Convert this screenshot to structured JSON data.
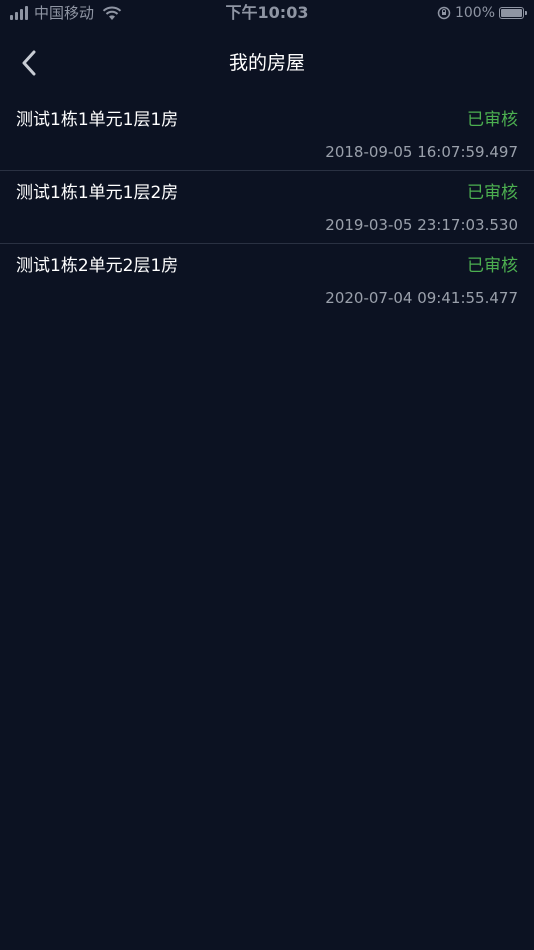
{
  "status_bar": {
    "carrier": "中国移动",
    "time": "下午10:03",
    "battery": "100%",
    "icons": [
      "signal-icon",
      "wifi-icon",
      "rotation-lock-icon",
      "battery-icon"
    ]
  },
  "nav": {
    "title": "我的房屋",
    "back_icon": "chevron-left-icon"
  },
  "houses": [
    {
      "name": "测试1栋1单元1层1房",
      "status": "已审核",
      "time": "2018-09-05 16:07:59.497"
    },
    {
      "name": "测试1栋1单元1层2房",
      "status": "已审核",
      "time": "2019-03-05 23:17:03.530"
    },
    {
      "name": "测试1栋2单元2层1房",
      "status": "已审核",
      "time": "2020-07-04 09:41:55.477"
    }
  ],
  "colors": {
    "background": "#0c1222",
    "status_approved": "#4caf50",
    "divider": "#2a3142"
  }
}
